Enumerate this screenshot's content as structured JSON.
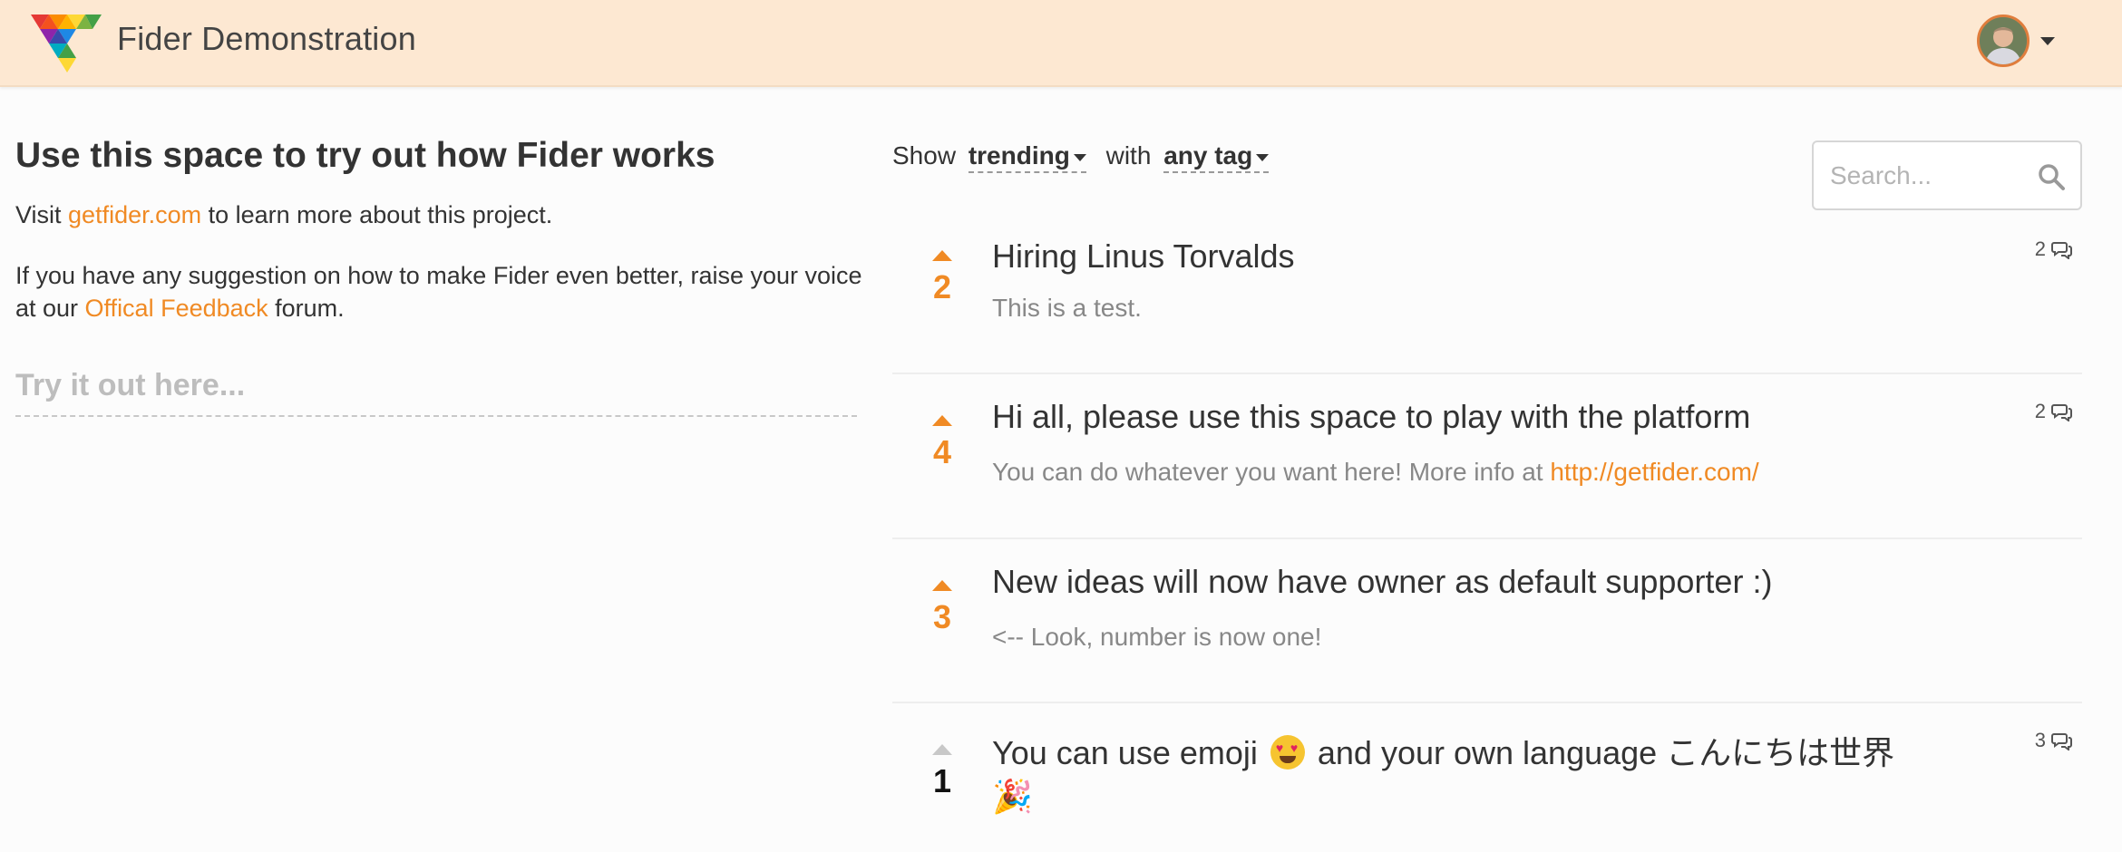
{
  "header": {
    "site_title": "Fider Demonstration",
    "brand_color": "#fde8d2",
    "logo_icon": "fider-logo-icon",
    "avatar_icon": "user-avatar"
  },
  "welcome": {
    "title": "Use this space to try out how Fider works",
    "p1_prefix": "Visit ",
    "p1_link": "getfider.com",
    "p1_suffix": " to learn more about this project.",
    "p2_prefix": "If you have any suggestion on how to make Fider even better, raise your voice at our ",
    "p2_link": "Offical Feedback",
    "p2_suffix": " forum.",
    "input_placeholder": "Try it out here..."
  },
  "filter": {
    "show_label": "Show",
    "view_value": "trending",
    "with_label": "with",
    "tag_value": "any tag"
  },
  "search": {
    "placeholder": "Search..."
  },
  "posts": [
    {
      "votes": "2",
      "title": "Hiring Linus Torvalds",
      "description": "This is a test.",
      "comments": "2"
    },
    {
      "votes": "4",
      "title": "Hi all, please use this space to play with the platform",
      "description_prefix": "You can do whatever you want here! More info at ",
      "description_link": "http://getfider.com/",
      "comments": "2"
    },
    {
      "votes": "3",
      "title": "New ideas will now have owner as default supporter :)",
      "description": "<-- Look, number is now one!"
    },
    {
      "votes": "1",
      "title_part1": "You can use emoji",
      "title_part2": " and your own language こんにちは世界",
      "title_line2_emoji": "🎉",
      "comments": "3"
    }
  ],
  "accent_color": "#f08a24"
}
